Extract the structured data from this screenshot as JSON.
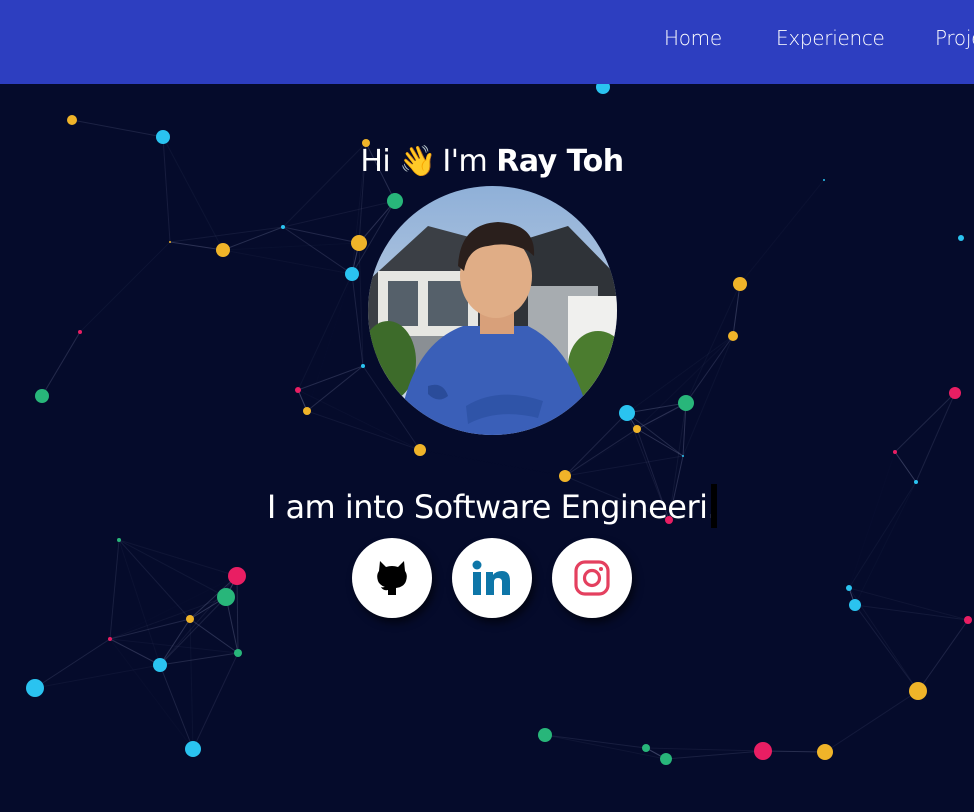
{
  "nav": {
    "items": [
      {
        "label": "Home"
      },
      {
        "label": "Experience"
      },
      {
        "label": "Proje"
      }
    ],
    "background": "#2d3ec0"
  },
  "hero": {
    "greeting_prefix": "Hi",
    "wave_emoji": "👋",
    "greeting_mid": "I'm",
    "name": "Ray Toh",
    "typing_text": "I am into Software Engineeri.",
    "background": "#050b2b"
  },
  "social": [
    {
      "icon": "github-icon",
      "color": "#000000"
    },
    {
      "icon": "linkedin-icon",
      "color": "#0e76a8"
    },
    {
      "icon": "instagram-icon",
      "color": "#e4405f"
    }
  ],
  "particle_colors": [
    "#2ac3f0",
    "#f0b429",
    "#28b67a",
    "#e91e63"
  ]
}
